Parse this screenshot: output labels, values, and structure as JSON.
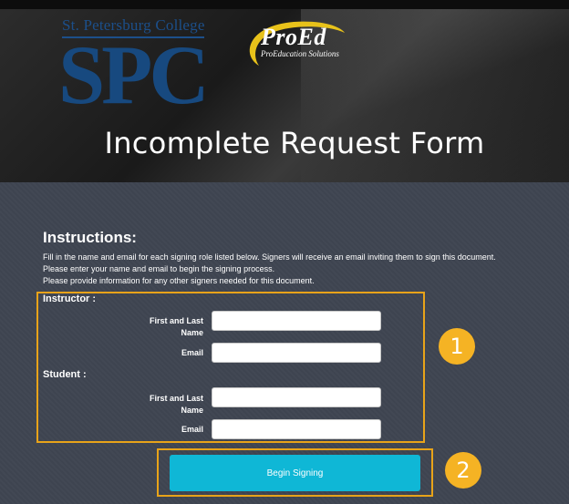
{
  "header": {
    "college_name": "St. Petersburg College",
    "college_abbr": "SPC",
    "partner_logo_title": "ProEd",
    "partner_logo_subtitle": "ProEducation Solutions",
    "form_title": "Incomplete Request Form"
  },
  "instructions": {
    "heading": "Instructions:",
    "lines": [
      "Fill in the name and email for each signing role listed below. Signers will receive an email inviting them to sign this document.",
      "Please enter your name and email to begin the signing process.",
      "Please provide information for any other signers needed for this document."
    ]
  },
  "roles": [
    {
      "label": "Instructor :",
      "name_label_1": "First and Last",
      "name_label_2": "Name",
      "email_label": "Email",
      "name_value": "",
      "email_value": ""
    },
    {
      "label": "Student :",
      "name_label_1": "First and Last",
      "name_label_2": "Name",
      "email_label": "Email",
      "name_value": "",
      "email_value": ""
    }
  ],
  "actions": {
    "begin_label": "Begin Signing"
  },
  "callouts": {
    "badge_1": "1",
    "badge_2": "2"
  },
  "colors": {
    "accent_button": "#0fb7d6",
    "highlight": "#e8a319",
    "badge": "#f5b324",
    "spc_blue": "#17497f"
  }
}
